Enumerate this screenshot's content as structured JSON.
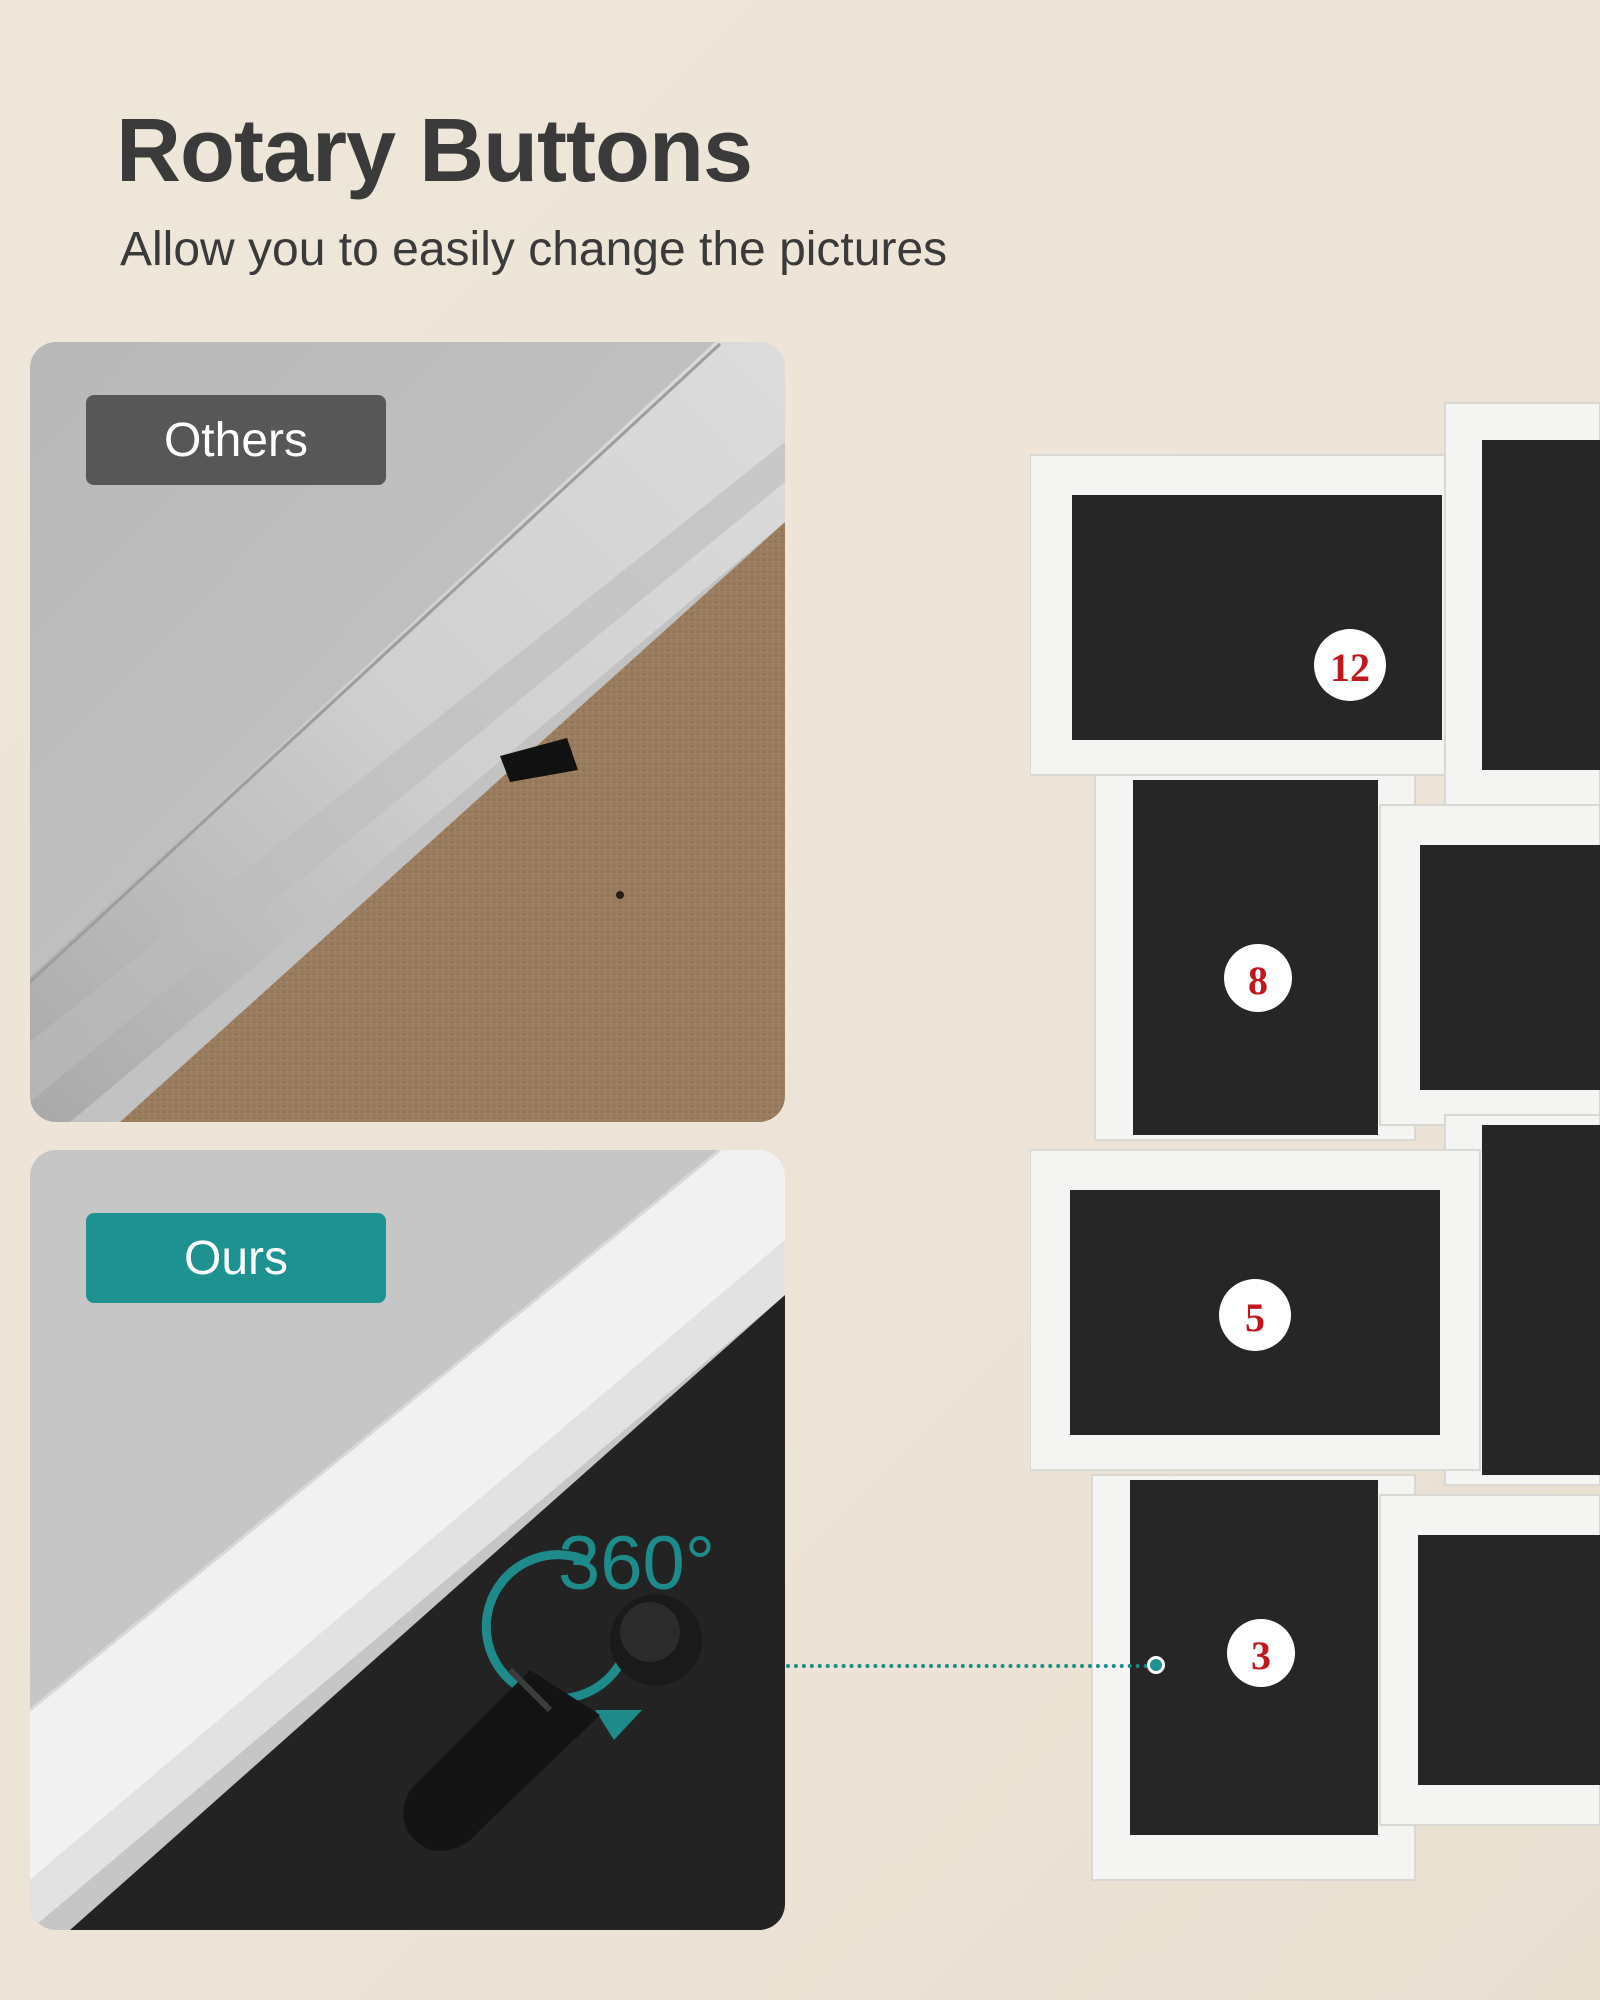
{
  "headline": "Rotary Buttons",
  "subline": "Allow you to easily change the pictures",
  "comparison": {
    "others_label": "Others",
    "ours_label": "Ours",
    "rotation_label": "360°"
  },
  "frame_numbers": [
    "12",
    "8",
    "5",
    "3"
  ],
  "colors": {
    "background": "#ede4d7",
    "accent": "#1e9191",
    "others_badge": "#575757",
    "text": "#3a3a3a",
    "number_red": "#c0181f"
  }
}
